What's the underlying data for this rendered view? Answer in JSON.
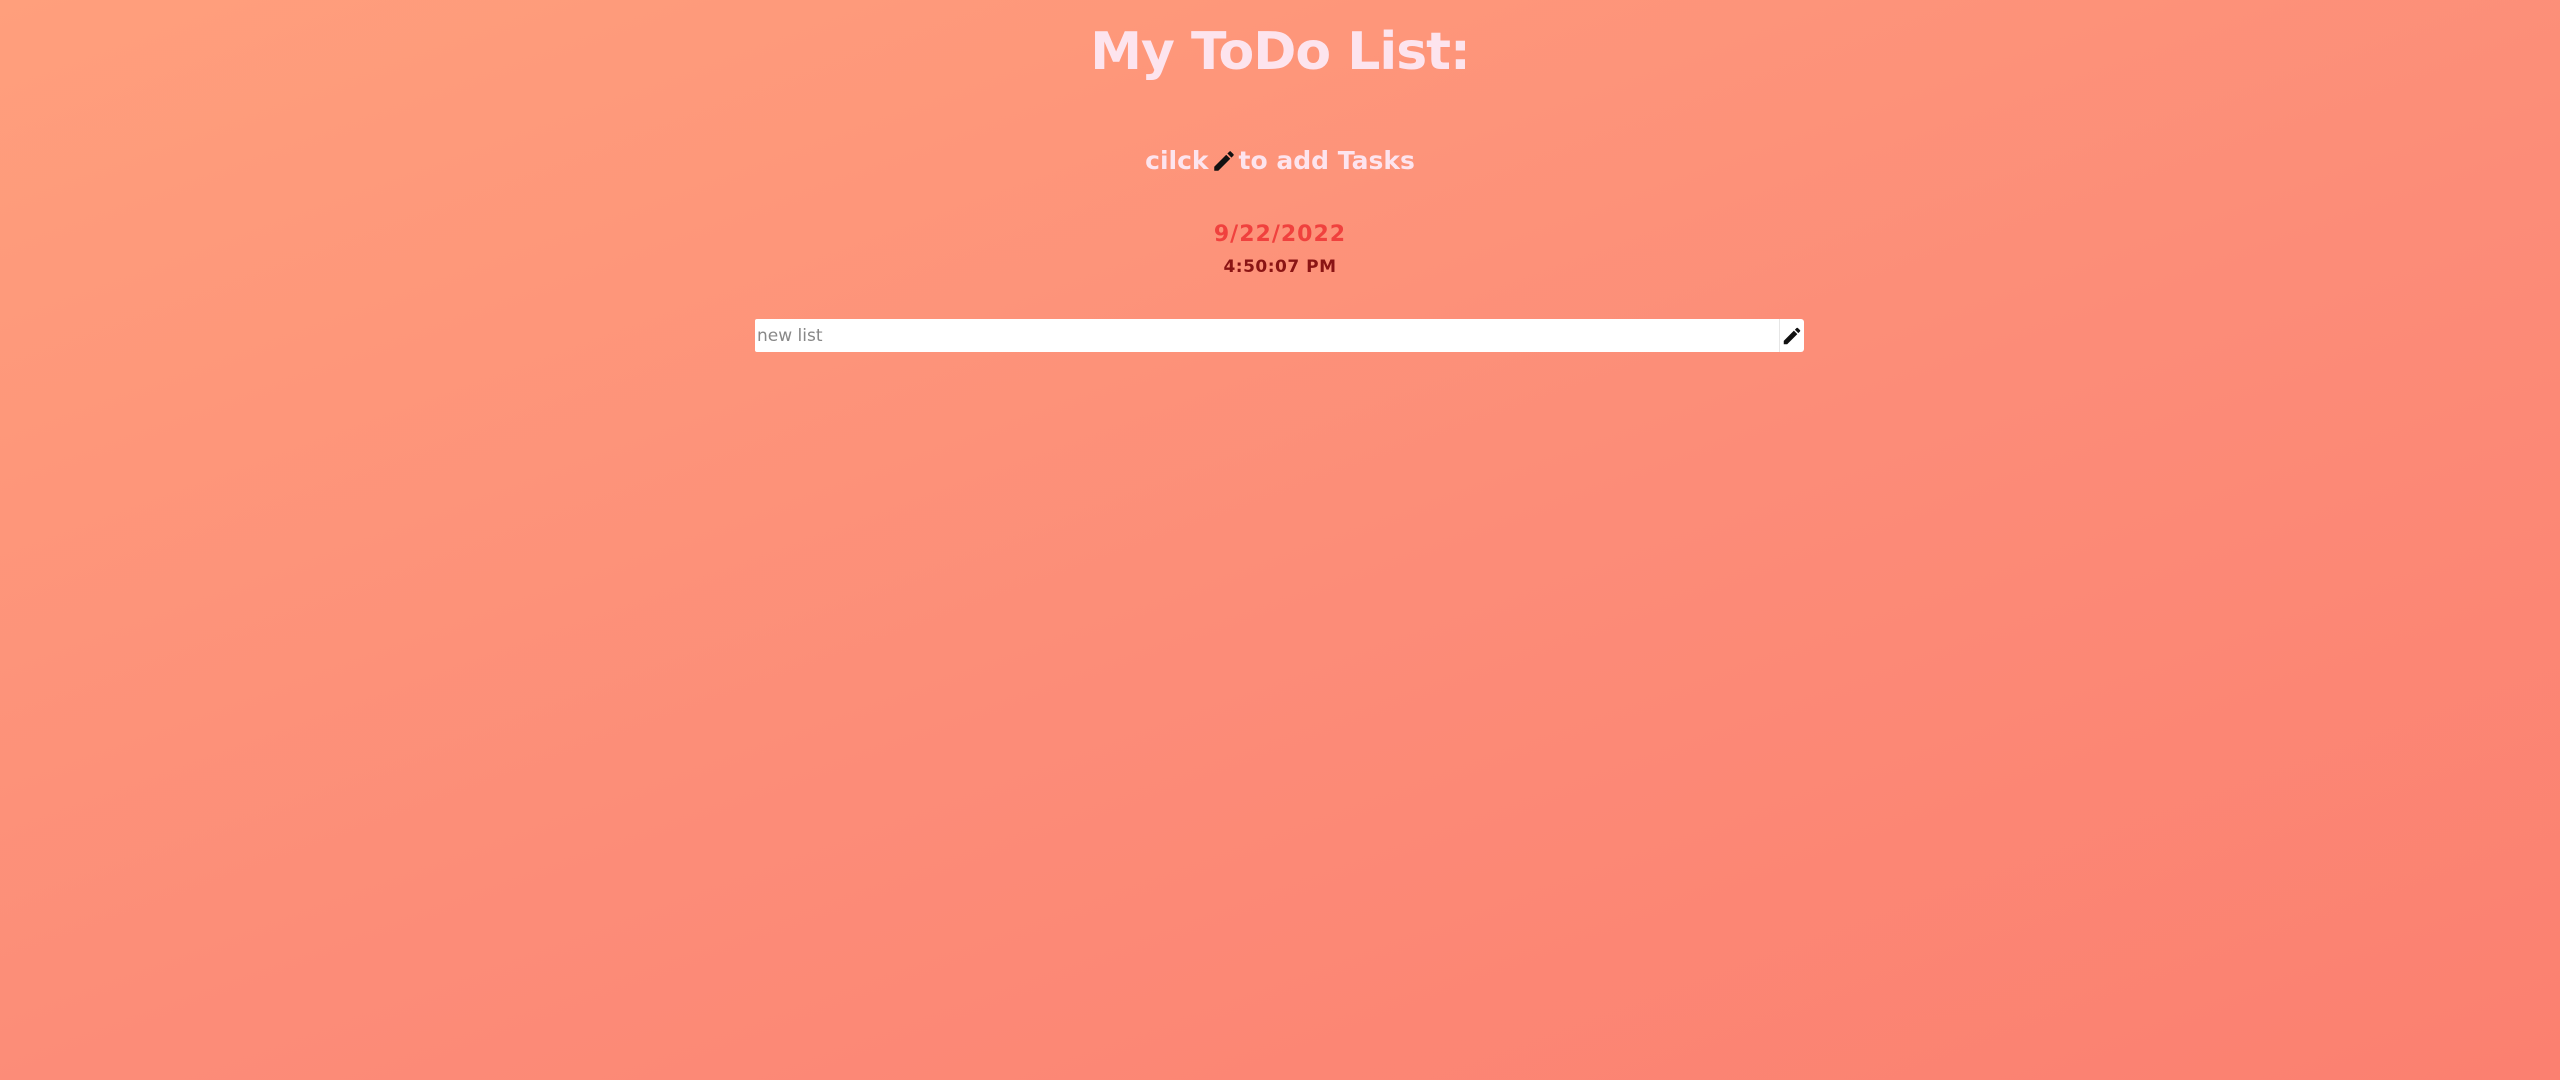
{
  "header": {
    "title": "My ToDo List:",
    "hint_prefix": "cilck",
    "hint_suffix": "to add Tasks",
    "hint_icon": "pencil-icon"
  },
  "clock": {
    "date": "9/22/2022",
    "time": "4:50:07 PM"
  },
  "new_list": {
    "placeholder": "new list",
    "value": "",
    "button_icon": "pencil-icon"
  },
  "colors": {
    "background_start": "#ff9f7c",
    "background_end": "#fb8070",
    "title": "#fde4ee",
    "date": "#f0413e",
    "time": "#8a1414"
  }
}
